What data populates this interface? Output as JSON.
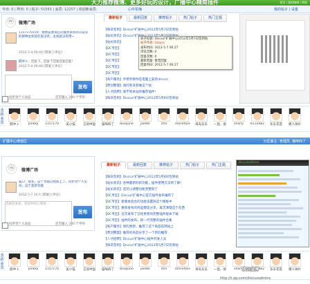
{
  "banner": {
    "title": "大力推荐微博、更多好玩的设计，广播中心精简插件",
    "right": "首页 | 我的微博 | 帮助"
  },
  "stats": {
    "text": "今日: 0 | 昨日: 0 | 帖子: 51563 | 会员: 12257 | 欢迎新会员: ",
    "new_member": "心中花梅",
    "right": "我的帖子 | 设置"
  },
  "weibo_top": {
    "title": "微博广场",
    "post_text": "1157170159：我想说我现在的服务商有的以前买的那种主机现在就没有，主机就没有用~",
    "post_meta": "2012-5-4 09:40 [转发] [评论]",
    "post2_author": "醉中卜：",
    "post2_text": "回复下，回复下回复回复回复！",
    "post2_meta": "2012-5-4 09:40 [转发] [评论]",
    "textarea_placeholder": "",
    "sync_label": "同步到个人动态",
    "counter": "还可输入 200 个字符",
    "publish": "发布"
  },
  "tabs_top": [
    "最新帖子",
    "最新回复",
    "推荐帖子",
    "热门帖子",
    "热门主题"
  ],
  "list_top": [
    "【每日签到】Discuz!扩展中心2012年5月7日签到帖",
    "【站长资讯】Discuz!扩展中心2012年5月7日签到帖",
    "【站长资讯】",
    "【DC专区】",
    "【DC专区】",
    "【DC专区】",
    "【DC专区】",
    "【DC专区】",
    "【商户服务】手把手教你在电脑上安装discuz",
    "【原创整理】请问有没有做这个站",
    "【人才招聘】收不到本站的推荐插件！",
    "【每日签到】Discuz!扩展中心2012年5月8日签到帖"
  ],
  "tooltip": {
    "title": "Discuz!扩展中心2012年5月7日签到帖",
    "rows": [
      "帖子标题: Discuz!扩展中心2012年5月7日签到帖",
      "帖子作者: [dayo]",
      "发布时间: 2012-5-7 06:27",
      "浏览次数: 0",
      "回复次数: 0",
      "最新回复: 暂无回复",
      "回复时间: 2012-5-7 06:27"
    ]
  },
  "strip_top": {
    "side": "活跃会员",
    "users": [
      "醉中卜",
      "pinkky",
      "1157170",
      "美小猫",
      "言语中国",
      "猫咪四了",
      "bluejune",
      "jaeder",
      "ctro",
      "stoneface",
      "海岛东东",
      "一直、很",
      "sharly",
      "6133482",
      "东东花苗",
      "墨人祥片"
    ]
  },
  "hdr2": {
    "left": "扩展中心增值区",
    "right_prefix": "分区版主: ",
    "right_names": "管理员, 猫咪四了"
  },
  "weibo_bottom": {
    "title": "微博广场",
    "post_text": "猫口：站长，这个功能已经加上了，同步到个人空间，这个是新功能",
    "post_meta": "2012-5-7 10:1 [转发] [评论]",
    "textarea_placeholder": "选择后发表，说说你的心情吧...",
    "sync_label": "同步到个人动态",
    "counter": "还可输入 200 个字符",
    "publish": "发布"
  },
  "tabs_bottom": [
    "最新帖子",
    "最新回复",
    "推荐帖子",
    "热门帖子",
    "热门主题"
  ],
  "list_bottom": [
    "【每日签到】Discuz!扩展中心2012年5月8日签到帖",
    "【站长资讯】各种最新的新功能，插件使用方法到了解！",
    "【站长资讯】还可以调整功能完整到了",
    "【DC专区】Discuz!扩展中心官方插件发布推荐了",
    "【DC专区】新版本后台的功能设置到这个模板中",
    "【DC专区】重新发布的商品都是分享，再次清理这个东西",
    "【DC专区】这次发布了已经更新的完整插件版本下载",
    "【DC专区】插件的发布，新一代完整的插件合集",
    "【商户服务】新的更新，推荐了这个商品在网站上",
    "【原创整理】推荐的商品分享了一个新的推荐",
    "【人才招聘】Discuz!扩展中心插件开发人员",
    "【每日签到】Discuz!扩展中心2012年5月7日签到帖"
  ],
  "shot": {
    "bar": "discuzadmins"
  },
  "strip_bottom": {
    "side": "活跃会员",
    "users": [
      "醉中卜",
      "pinkky",
      "1157170",
      "美小猫",
      "言语中国",
      "猫咪四了",
      "bluejune",
      "jaeder",
      "ctro",
      "stoneface",
      "海岛东东",
      "一直、很",
      "sharly",
      "6133482",
      "东东花苗",
      "墨人祥片"
    ]
  },
  "watermark": "腾讯微博",
  "url": "http://t.qq.com/discuzadmins"
}
